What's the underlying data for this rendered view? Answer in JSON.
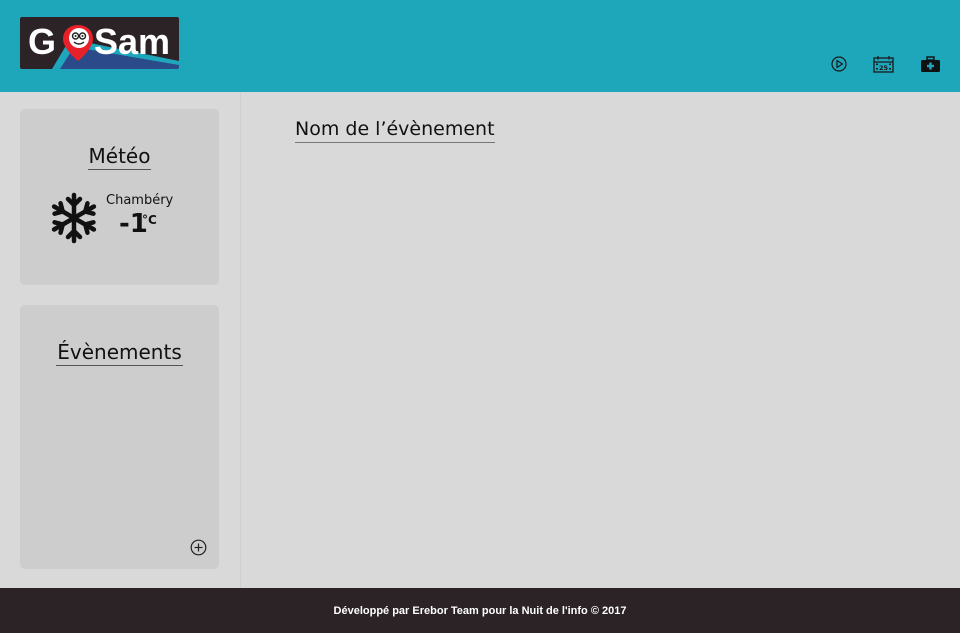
{
  "header": {
    "logo": {
      "left_text": "G",
      "right_text": "Sam",
      "background": "#2b2326",
      "accent": "#e8202a"
    },
    "background": "#1ea6bb",
    "icons": [
      {
        "name": "play-circle-icon",
        "interactable": true
      },
      {
        "name": "calendar-icon",
        "text": "25",
        "interactable": true
      },
      {
        "name": "first-aid-kit-icon",
        "interactable": true
      }
    ]
  },
  "sidebar": {
    "weather_card": {
      "title": "Météo",
      "icon": "snowflake-icon",
      "city": "Chambéry",
      "temperature": "-1",
      "unit": "°C"
    },
    "events_card": {
      "title": "Évènements",
      "add_icon": "add-circle-icon"
    }
  },
  "main": {
    "title": "Nom de l’évènement"
  },
  "footer": {
    "text": "Développé par Erebor Team pour la Nuit de l'info © 2017"
  }
}
